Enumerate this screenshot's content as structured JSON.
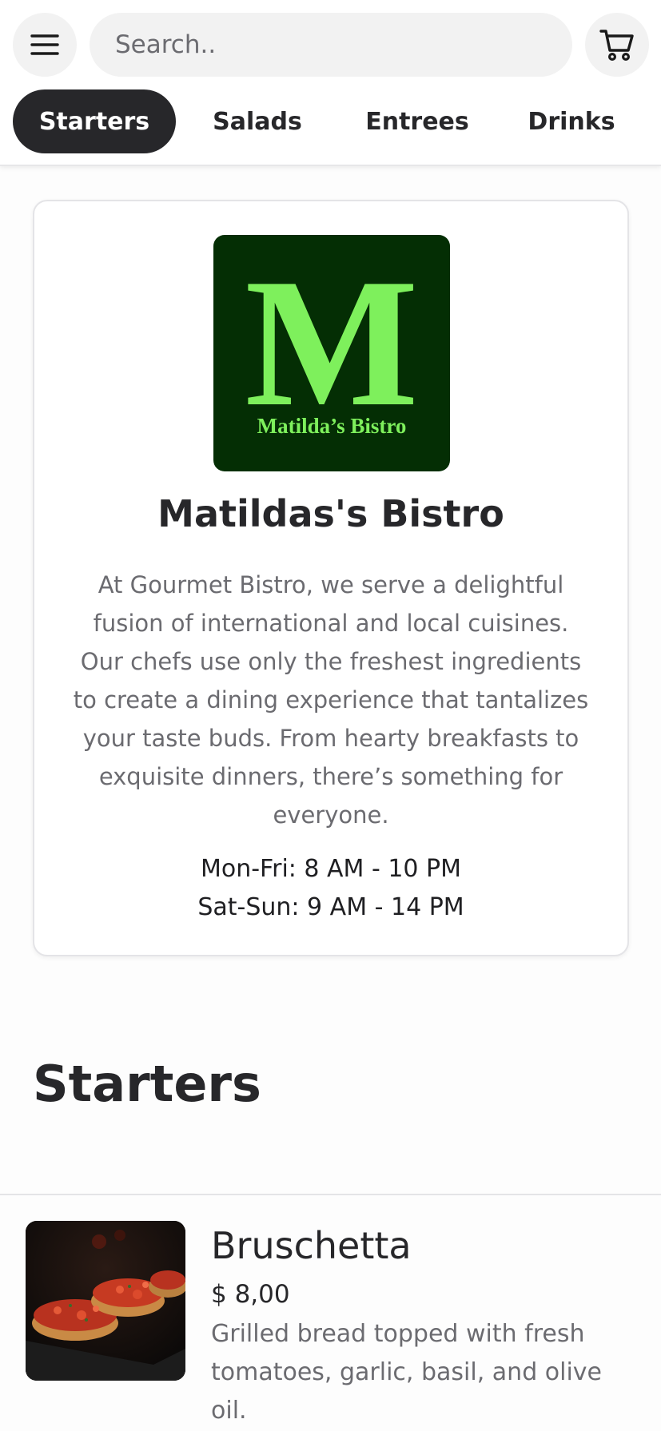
{
  "header": {
    "menu_icon": "hamburger-menu-icon",
    "search_placeholder": "Search..",
    "cart_icon": "shopping-cart-icon"
  },
  "tabs": [
    {
      "label": "Starters",
      "active": true
    },
    {
      "label": "Salads",
      "active": false
    },
    {
      "label": "Entrees",
      "active": false
    },
    {
      "label": "Drinks",
      "active": false
    }
  ],
  "restaurant": {
    "logo_letter": "M",
    "logo_text": "Matilda’s Bistro",
    "logo_bg_color": "#042e04",
    "logo_fg_color": "#7ef05c",
    "name": "Matildas's Bistro",
    "description": "At Gourmet Bistro, we serve a delightful fusion of international and local cuisines. Our chefs use only the freshest ingredients to create a dining experience that tantalizes your taste buds. From hearty breakfasts to exquisite dinners, there’s something for everyone.",
    "hours": [
      "Mon-Fri: 8 AM - 10 PM",
      "Sat-Sun: 9 AM - 14 PM"
    ]
  },
  "section": {
    "title": "Starters"
  },
  "items": [
    {
      "name": "Bruschetta",
      "price": "$ 8,00",
      "description": "Grilled bread topped with fresh tomatoes, garlic, basil, and olive oil."
    }
  ]
}
